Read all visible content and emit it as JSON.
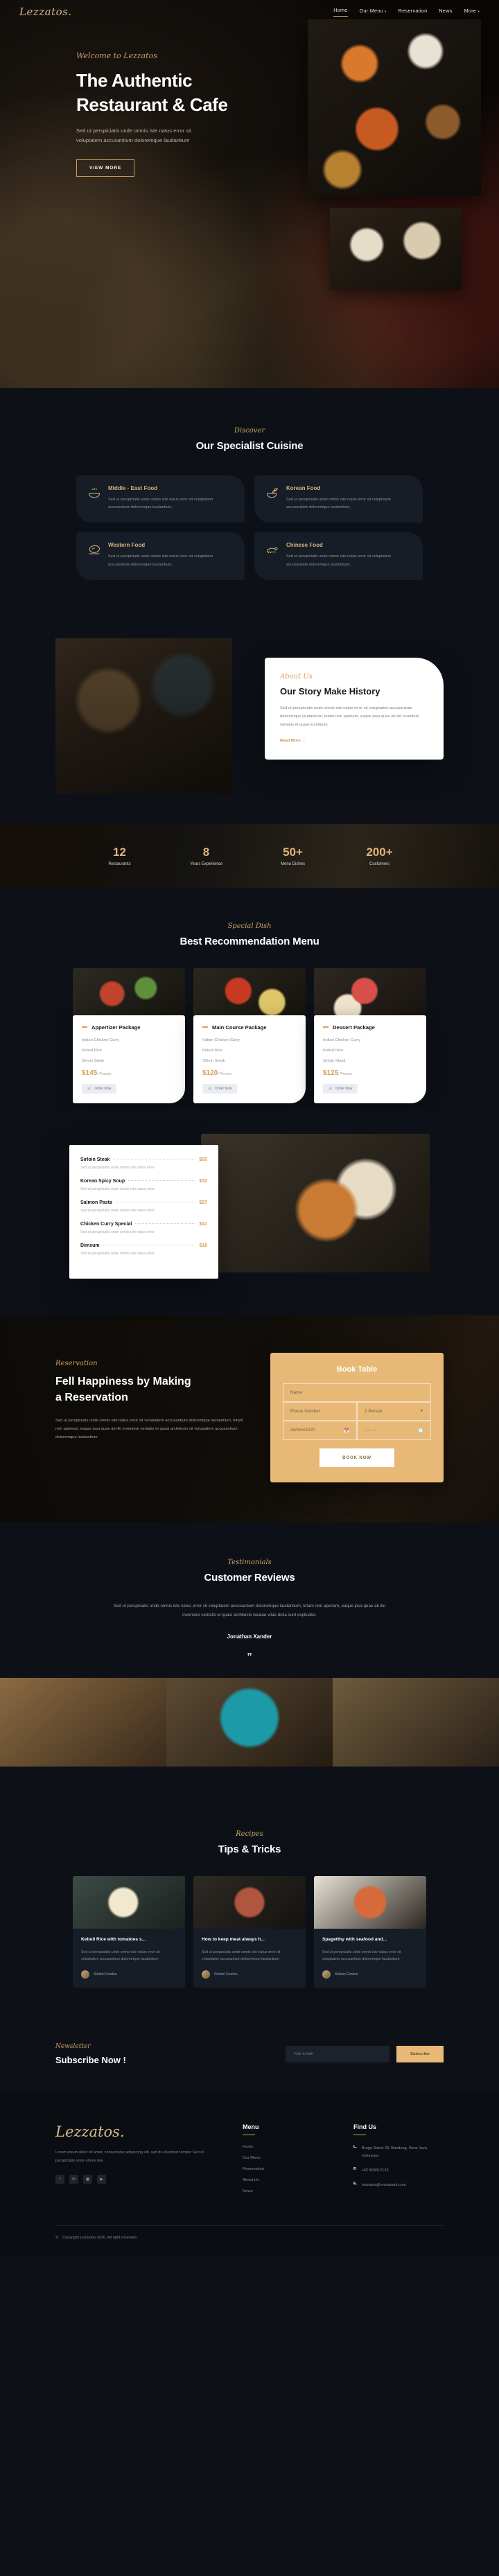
{
  "nav": {
    "brand": "Lezzatos.",
    "links": [
      {
        "label": "Home",
        "caret": ""
      },
      {
        "label": "Our Menu",
        "caret": "▾"
      },
      {
        "label": "Reservation",
        "caret": ""
      },
      {
        "label": "News",
        "caret": ""
      },
      {
        "label": "More",
        "caret": "▾"
      }
    ]
  },
  "hero": {
    "eyebrow": "Welcome to Lezzatos",
    "title_line1": "The Authentic",
    "title_line2": "Restaurant & Cafe",
    "desc": "Sed ut perspiciatis unde omnis iste natus error sit voluptatem accusantium doloremque laudantium",
    "cta": "VIEW MORE"
  },
  "cuisine": {
    "eyebrow": "Discover",
    "title": "Our Specialist Cuisine",
    "cards": [
      {
        "name": "Middle - East Food",
        "desc": "Sed ut perspiciatis unde omnis iste natus error sit voluptatem accusantium doloremque laudantium,",
        "icon": "soup-bowl-icon"
      },
      {
        "name": "Korean Food",
        "desc": "Sed ut perspiciatis unde omnis iste natus error sit voluptatem accusantium doloremque laudantium,",
        "icon": "noodle-bowl-icon"
      },
      {
        "name": "Western Food",
        "desc": "Sed ut perspiciatis unde omnis iste natus error sit voluptatem accusantium doloremque laudantium,",
        "icon": "steak-icon"
      },
      {
        "name": "Chinese Food",
        "desc": "Sed ut perspiciatis unde omnis iste natus error sit voluptatem accusantium doloremque laudantium,",
        "icon": "roast-chicken-icon"
      }
    ]
  },
  "about": {
    "eyebrow": "About Us",
    "title": "Our Story Make History",
    "desc": "Sed ut perspiciatis unde omnis iste natus error sit voluptatem accusantium doloremque laudantium, totam rem aperiam, eaque ipsa quae ab illo inventore veritatis et quasi architecto",
    "read_more": "Read More  →"
  },
  "stats": [
    {
      "value": "12",
      "label": "Restaurants"
    },
    {
      "value": "8",
      "label": "Years Experience"
    },
    {
      "value": "50+",
      "label": "Menu Dishes"
    },
    {
      "value": "200+",
      "label": "Customers"
    }
  ],
  "packages": {
    "eyebrow": "Special Dish",
    "title": "Best Recommendation Menu",
    "items": [
      {
        "title": "Appertizer Package",
        "dishes": [
          "Indian Chicken Curry",
          "Kebuli Rice",
          "Sirloin Steak"
        ],
        "price": "$145",
        "unit": "/ Person",
        "button": "Order Now"
      },
      {
        "title": "Main Course Package",
        "dishes": [
          "Indian Chicken Curry",
          "Kebuli Rice",
          "Sirloin Steak"
        ],
        "price": "$120",
        "unit": "/ Person",
        "button": "Order Now"
      },
      {
        "title": "Dessert Package",
        "dishes": [
          "Indian Chicken Curry",
          "Kebuli Rice",
          "Sirloin Steak"
        ],
        "price": "$125",
        "unit": "/ Person",
        "button": "Order Now"
      }
    ]
  },
  "menu_list": [
    {
      "name": "Sirloin Steak",
      "price": "$55",
      "desc": "Sed ut perspiciatis unde omnis iste natus error"
    },
    {
      "name": "Korean Spicy Soup",
      "price": "$32",
      "desc": "Sed ut perspiciatis unde omnis iste natus error"
    },
    {
      "name": "Salmon Pasta",
      "price": "$27",
      "desc": "Sed ut perspiciatis unde omnis iste natus error"
    },
    {
      "name": "Chicken Curry Special",
      "price": "$41",
      "desc": "Sed ut perspiciatis unde omnis iste natus error"
    },
    {
      "name": "Dimsum",
      "price": "$18",
      "desc": "Sed ut perspiciatis unde omnis iste natus error"
    }
  ],
  "reservation": {
    "eyebrow": "Reservation",
    "title_line1": "Fell Happiness by Making",
    "title_line2": "a Reservation",
    "desc": "Sed ut perspiciatis unde omnis iste natus error sit voluptatem accusantium doloremque laudantium, totam rem aperiam, eaque ipsa quae ab illo inventore veritatis et quasi architecto sit voluptatem accusantium doloremque laudantium",
    "form_title": "Book Table",
    "name_placeholder": "Name",
    "phone_placeholder": "Phone Number",
    "person_value": "2 Person",
    "date_value": "dd/mm/2020",
    "time_value": "--:-- --",
    "submit": "BOOK NOW"
  },
  "testimonials": {
    "eyebrow": "Testimonials",
    "title": "Customer Reviews",
    "text": "Sed ut perspiciatis unde omnis iste natus error sit voluptatem accusantium doloremque laudantium, totam rem aperiam, eaque ipsa quae ab illo inventore veritatis et quasi architecto beatae vitae dicta sunt explicabo.",
    "author": "Jonathan Xander",
    "quote_glyph": "”"
  },
  "tips": {
    "eyebrow": "Recipes",
    "title": "Tips & Tricks",
    "posts": [
      {
        "title": "Kebuli Rice with tomatoes s...",
        "desc": "Sed ut perspiciatis unde omnis iste natus error sit voluptatem accusantium doloremque laudantium",
        "author": "Stefani Gordon"
      },
      {
        "title": "How to keep meat always h...",
        "desc": "Sed ut perspiciatis unde omnis iste natus error sit voluptatem accusantium doloremque laudantium",
        "author": "Stefani Gordon"
      },
      {
        "title": "Spagetthy with seafood and...",
        "desc": "Sed ut perspiciatis unde omnis iste natus error sit voluptatem accusantium doloremque laudantium",
        "author": "Stefani Gordon"
      }
    ]
  },
  "newsletter": {
    "eyebrow": "Newsletter",
    "title": "Subscribe Now !",
    "placeholder": "Your Email",
    "button": "Subscribe"
  },
  "footer": {
    "brand": "Lezzatos.",
    "desc": "Lorem ipsum dolor sit amet, consectetur adipiscing elit, sed do eiusmod tempor Sed ut perspiciatis unde omnis iste",
    "socials": [
      "facebook-icon",
      "twitter-icon",
      "instagram-icon",
      "youtube-icon"
    ],
    "social_glyphs": [
      "f",
      "✉",
      "▣",
      "▶"
    ],
    "menu_heading": "Menu",
    "menu_links": [
      "Home",
      "Our Menu",
      "Reservation",
      "About Us",
      "News"
    ],
    "find_heading": "Find Us",
    "contacts": [
      {
        "key": "L.",
        "value": "Braga Street 28, Bandung, West Java, Indonesia"
      },
      {
        "key": "P.",
        "value": "+62 863812123"
      },
      {
        "key": "E.",
        "value": "lezzatos@restaurant.com"
      }
    ],
    "copyright": "Copyright Lezzatos 2020, All right reserved.",
    "copyright_glyph": "©"
  }
}
